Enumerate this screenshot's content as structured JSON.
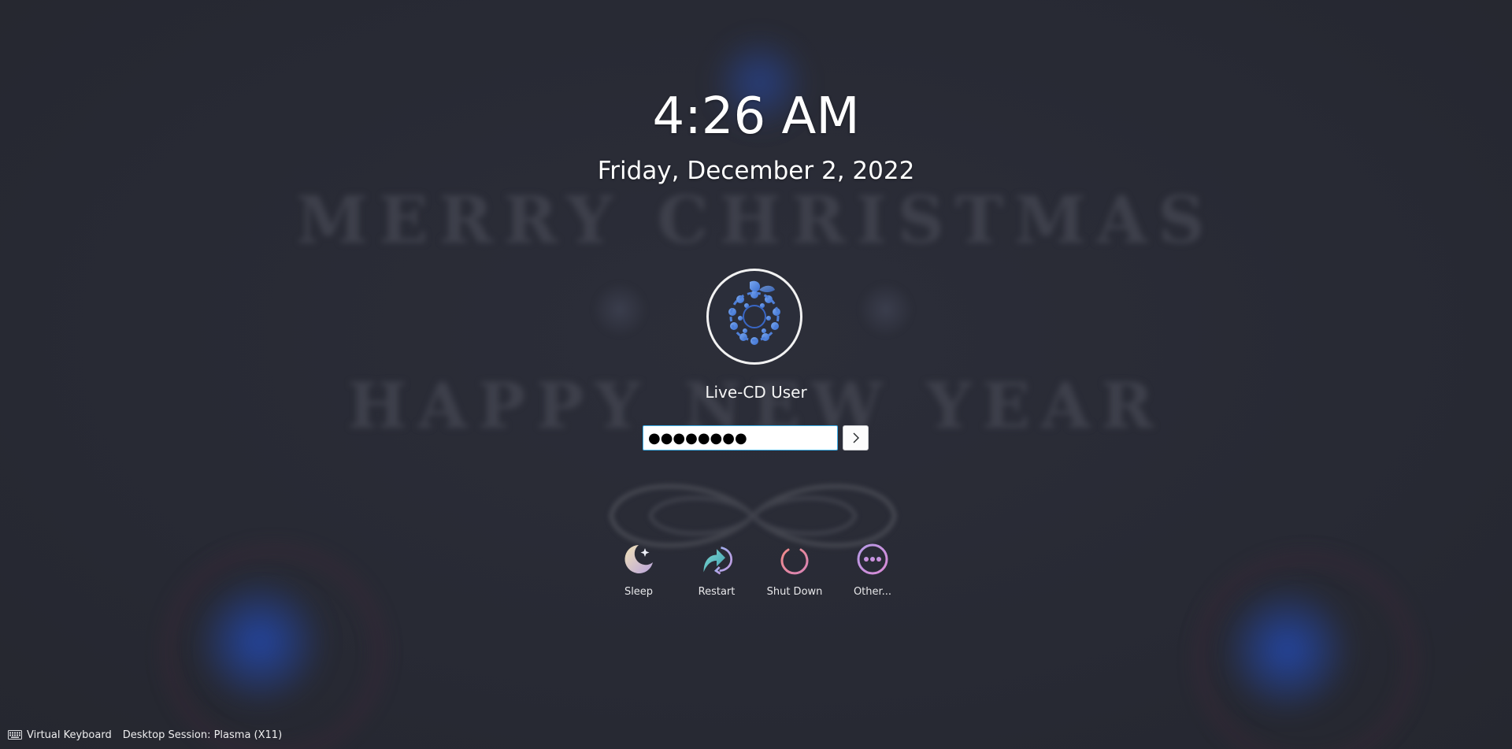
{
  "clock": {
    "time": "4:26 AM",
    "date": "Friday, December 2, 2022"
  },
  "user": {
    "name": "Live-CD User"
  },
  "password": {
    "value": "●●●●●●●●"
  },
  "actions": [
    {
      "label": "Sleep",
      "icon": "sleep-icon"
    },
    {
      "label": "Restart",
      "icon": "restart-icon"
    },
    {
      "label": "Shut Down",
      "icon": "shutdown-icon"
    },
    {
      "label": "Other...",
      "icon": "more-icon"
    }
  ],
  "bottom_bar": {
    "virtual_keyboard": "Virtual Keyboard",
    "desktop_session": "Desktop Session: Plasma (X11)"
  },
  "wallpaper": {
    "line1": "MERRY CHRISTMAS",
    "line2": "HAPPY NEW YEAR"
  },
  "colors": {
    "background": "#2a2c36",
    "focus_border": "#3daee9",
    "sleep_gradient_start": "#f0e2b6",
    "restart_gradient_start": "#5cc7c4",
    "shutdown_color": "#e0808c",
    "other_color": "#c48ae0"
  }
}
